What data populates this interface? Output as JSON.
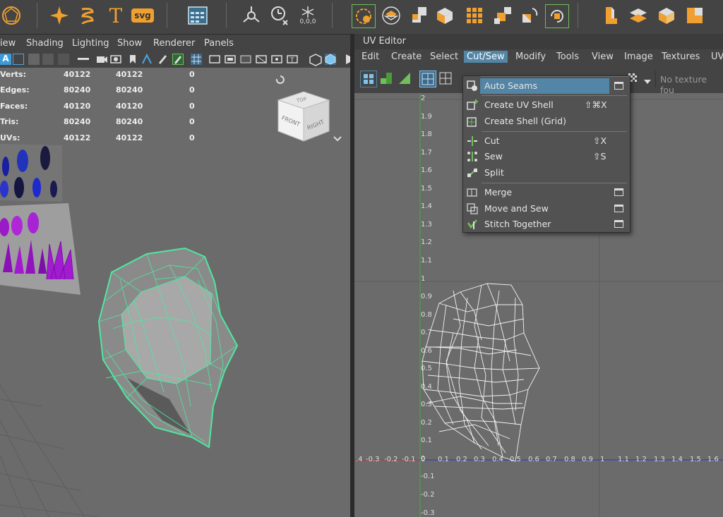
{
  "shelf": {
    "icons": [
      "polygon-primitive-icon",
      "sparkle-icon",
      "helix-icon",
      "text-icon",
      "svg-icon",
      "grid-panel-icon",
      "pivot-icon",
      "timer-icon",
      "snowflake-icon",
      "circle-selection-icon",
      "uv-layout-icon",
      "cut-squares-icon",
      "cube-faces-icon",
      "grid-squares-icon",
      "staircase-icon",
      "rotate-uv-icon",
      "rotate-uv-2-icon",
      "box-bend-icon",
      "plane-split-icon",
      "cube-icon",
      "tile-icon"
    ],
    "svg_label": "svg",
    "text_label": "T",
    "snow_coords": "0,0,0"
  },
  "viewport_menu": [
    "iew",
    "Shading",
    "Lighting",
    "Show",
    "Renderer",
    "Panels"
  ],
  "hud": {
    "rows": [
      {
        "label": "Verts:",
        "a": "40122",
        "b": "40122",
        "c": "0"
      },
      {
        "label": "Edges:",
        "a": "80240",
        "b": "80240",
        "c": "0"
      },
      {
        "label": "Faces:",
        "a": "40120",
        "b": "40120",
        "c": "0"
      },
      {
        "label": "Tris:",
        "a": "80240",
        "b": "80240",
        "c": "0"
      },
      {
        "label": "UVs:",
        "a": "40122",
        "b": "40122",
        "c": "0"
      }
    ]
  },
  "viewcube": {
    "top": "TOP",
    "front": "FRONT",
    "right": "RIGHT"
  },
  "uv_editor": {
    "title": "UV Editor",
    "menu": [
      "Edit",
      "Create",
      "Select",
      "Cut/Sew",
      "Modify",
      "Tools",
      "View",
      "Image",
      "Textures",
      "UV"
    ],
    "active_menu": "Cut/Sew",
    "no_texture": "No texture fou",
    "v_ticks": [
      "2",
      "1.9",
      "1.8",
      "1.7",
      "1.6",
      "1.5",
      "1.4",
      "1.3",
      "1.2",
      "1.1",
      "1",
      "0.9",
      "0.8",
      "0.7",
      "0.6",
      "0.5",
      "0.4",
      "0.3",
      "0.2",
      "0.1",
      "0",
      "-0.1",
      "-0.2",
      "-0.3"
    ],
    "u_ticks": [
      ".4",
      "-0.3",
      "-0.2",
      "-0.1",
      "0",
      "0.1",
      "0.2",
      "0.3",
      "0.4",
      "0.5",
      "0.6",
      "0.7",
      "0.8",
      "0.9",
      "1",
      "1.1",
      "1.2",
      "1.3",
      "1.4",
      "1.5",
      "1.6"
    ]
  },
  "cut_sew_menu": {
    "items": [
      {
        "label": "Auto Seams",
        "shortcut": "",
        "option_box": true,
        "highlighted": true,
        "icon": "auto-seams-icon"
      },
      {
        "label": "Create UV Shell",
        "shortcut": "⇧⌘X",
        "option_box": false,
        "icon": "create-uv-shell-icon"
      },
      {
        "label": "Create Shell (Grid)",
        "shortcut": "",
        "option_box": false,
        "icon": "create-shell-grid-icon"
      },
      {
        "label": "Cut",
        "shortcut": "⇧X",
        "option_box": false,
        "icon": "cut-icon"
      },
      {
        "label": "Sew",
        "shortcut": "⇧S",
        "option_box": false,
        "icon": "sew-icon"
      },
      {
        "label": "Split",
        "shortcut": "",
        "option_box": false,
        "icon": "split-icon"
      },
      {
        "label": "Merge",
        "shortcut": "",
        "option_box": true,
        "icon": "merge-icon"
      },
      {
        "label": "Move and Sew",
        "shortcut": "",
        "option_box": true,
        "icon": "move-and-sew-icon"
      },
      {
        "label": "Stitch Together",
        "shortcut": "",
        "option_box": true,
        "icon": "stitch-together-icon"
      }
    ]
  },
  "colors": {
    "accent": "#5285a6",
    "orange": "#f0a030",
    "wire_green": "#4ee8a0",
    "wire_white": "#f2f2f2"
  }
}
